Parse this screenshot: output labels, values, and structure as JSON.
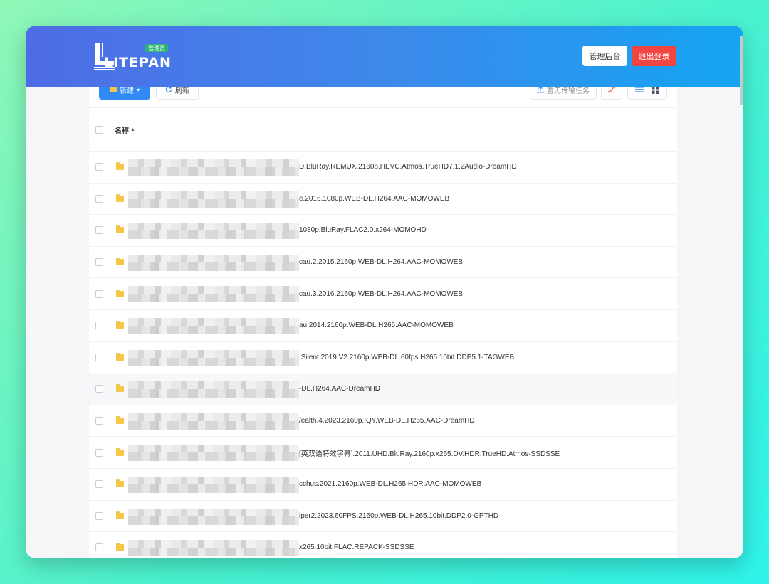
{
  "header": {
    "logo_text": "LITEPAN",
    "admin_badge": "管理员",
    "admin_button": "管理后台",
    "logout_button": "退出登录"
  },
  "toolbar": {
    "new_label": "新建",
    "refresh_label": "刷新",
    "transfer_label": "暂无传输任务"
  },
  "table": {
    "column_name": "名称",
    "sort_indicator": "▲",
    "rows": [
      {
        "name": "D.BluRay.REMUX.2160p.HEVC.Atmos.TrueHD7.1.2Audio-DreamHD"
      },
      {
        "name": "e.2016.1080p.WEB-DL.H264.AAC-MOMOWEB"
      },
      {
        "name": "1080p.BluRay.FLAC2.0.x264-MOMOHD"
      },
      {
        "name": "cau.2.2015.2160p.WEB-DL.H264.AAC-MOMOWEB"
      },
      {
        "name": "cau.3.2016.2160p.WEB-DL.H264.AAC-MOMOWEB"
      },
      {
        "name": "au.2014.2160p.WEB-DL.H265.AAC-MOMOWEB"
      },
      {
        "name": ".Silent.2019.V2.2160p.WEB-DL.60fps.H265.10bit.DDP5.1-TAGWEB"
      },
      {
        "name": "-DL.H264.AAC-DreamHD"
      },
      {
        "name": "/ealth.4.2023.2160p.IQY.WEB-DL.H265.AAC-DreamHD"
      },
      {
        "name": "[英双语特效字幕].2011.UHD.BluRay.2160p.x265.DV.HDR.TrueHD.Atmos-SSDSSE"
      },
      {
        "name": "cchus.2021.2160p.WEB-DL.H265.HDR.AAC-MOMOWEB"
      },
      {
        "name": "iper2.2023.60FPS.2160p.WEB-DL.H265.10bit.DDP2.0-GPTHD"
      },
      {
        "name": "x265.10bit.FLAC.REPACK-SSDSSE"
      }
    ]
  },
  "colors": {
    "header_start": "#4f6ce6",
    "header_end": "#14a5f2",
    "primary": "#2f8af5",
    "danger": "#f04542",
    "folder": "#f7c649"
  }
}
